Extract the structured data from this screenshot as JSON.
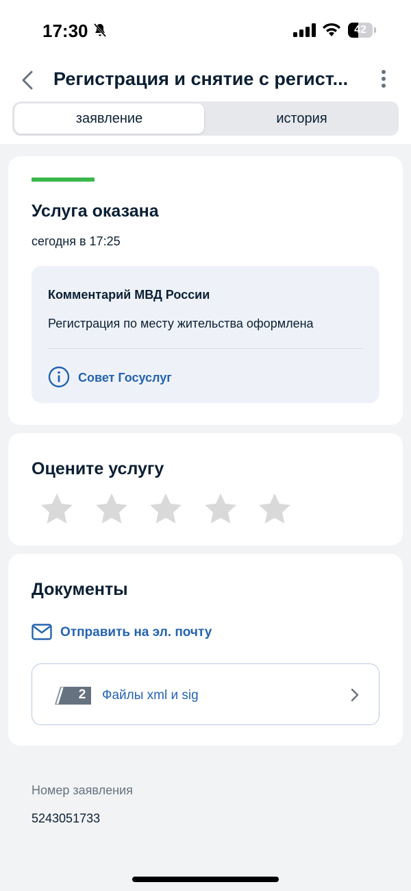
{
  "status_bar": {
    "time": "17:30",
    "battery_level": "42",
    "battery_fraction": 0.42
  },
  "header": {
    "title": "Регистрация и снятие с регист..."
  },
  "tabs": [
    {
      "label": "заявление",
      "active": true
    },
    {
      "label": "история",
      "active": false
    }
  ],
  "status_card": {
    "status": "Услуга оказана",
    "time": "сегодня в 17:25",
    "comment": {
      "title": "Комментарий МВД России",
      "text": "Регистрация по месту жительства оформлена",
      "tip_link": "Совет Госуслуг"
    },
    "status_color": "#3ab74c"
  },
  "rating": {
    "title": "Оцените услугу",
    "stars_total": 5,
    "stars_selected": 0
  },
  "documents": {
    "title": "Документы",
    "send_email": "Отправить на эл. почту",
    "files_count": "2",
    "files_label": "Файлы xml и sig"
  },
  "application": {
    "number_label": "Номер заявления",
    "number": "5243051733"
  },
  "colors": {
    "accent": "#2463b0",
    "background": "#f2f3f5",
    "star": "#d9d9d9"
  }
}
